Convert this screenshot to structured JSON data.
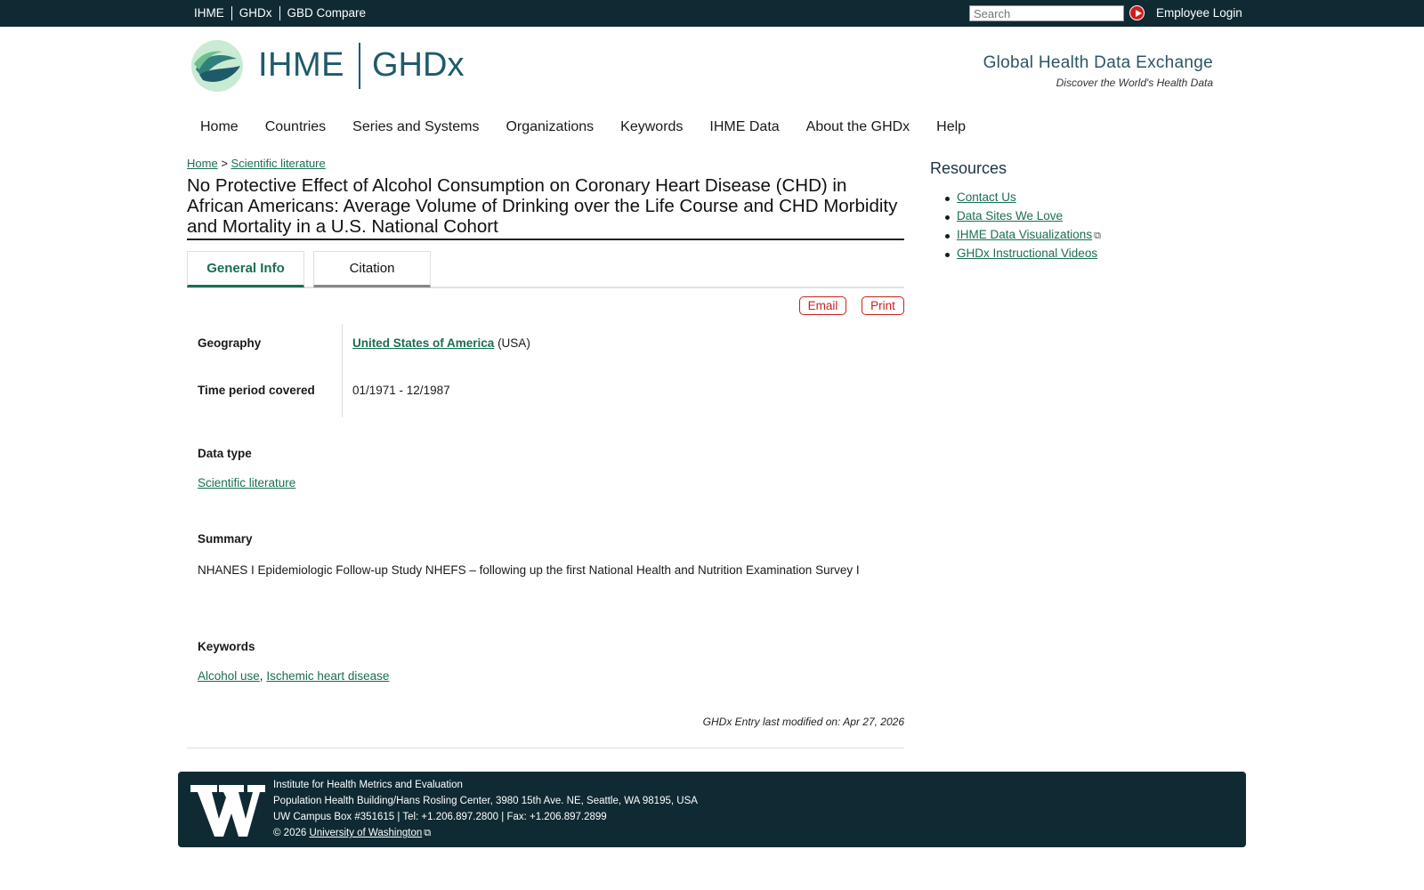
{
  "topbar": {
    "links": [
      "IHME",
      "GHDx",
      "GBD Compare"
    ],
    "search_placeholder": "Search",
    "login": "Employee Login"
  },
  "header": {
    "logo_left": "IHME",
    "logo_right": "GHDx",
    "tagline": "Global Health Data Exchange",
    "subtagline": "Discover the World's Health Data"
  },
  "nav": [
    "Home",
    "Countries",
    "Series and Systems",
    "Organizations",
    "Keywords",
    "IHME Data",
    "About the GHDx",
    "Help"
  ],
  "breadcrumb": {
    "home": "Home",
    "sep": ">",
    "section": "Scientific literature"
  },
  "title": "No Protective Effect of Alcohol Consumption on Coronary Heart Disease (CHD) in African Americans: Average Volume of Drinking over the Life Course and CHD Morbidity and Mortality in a U.S. National Cohort",
  "tabs": [
    "General Info",
    "Citation"
  ],
  "actions": {
    "email": "Email",
    "print": "Print"
  },
  "details": {
    "geography_label": "Geography",
    "geography_value": "United States of America",
    "geography_code": "(USA)",
    "time_label": "Time period covered",
    "time_value": "01/1971 - 12/1987",
    "datatype_label": "Data type",
    "datatype_value": "Scientific literature",
    "summary_label": "Summary",
    "summary_value": "NHANES I Epidemiologic Follow-up Study NHEFS – following up the first National Health and Nutrition Examination Survey I",
    "keywords_label": "Keywords",
    "keyword_1": "Alcohol use",
    "keyword_sep": ",",
    "keyword_2": "Ischemic heart disease",
    "modified": "GHDx Entry last modified on: Apr 27, 2026"
  },
  "sidebar": {
    "title": "Resources",
    "items": [
      "Contact Us",
      "Data Sites We Love",
      "IHME Data Visualizations",
      "GHDx Instructional Videos"
    ]
  },
  "footer": {
    "line1": "Institute for Health Metrics and Evaluation",
    "line2": "Population Health Building/Hans Rosling Center, 3980 15th Ave. NE, Seattle, WA 98195, USA",
    "line3": "UW Campus Box #351615 | Tel: +1.206.897.2800 | Fax: +1.206.897.2899",
    "copyright": "© 2026",
    "uw_link": "University of Washington"
  },
  "colors": {
    "topbar": "#0f2a33",
    "link": "#1a6e52",
    "accent_red": "#c8201f"
  },
  "icons": [
    "ihme-leaf-logo-icon",
    "search-go-icon",
    "external-link-icon",
    "uw-w-logo-icon"
  ]
}
